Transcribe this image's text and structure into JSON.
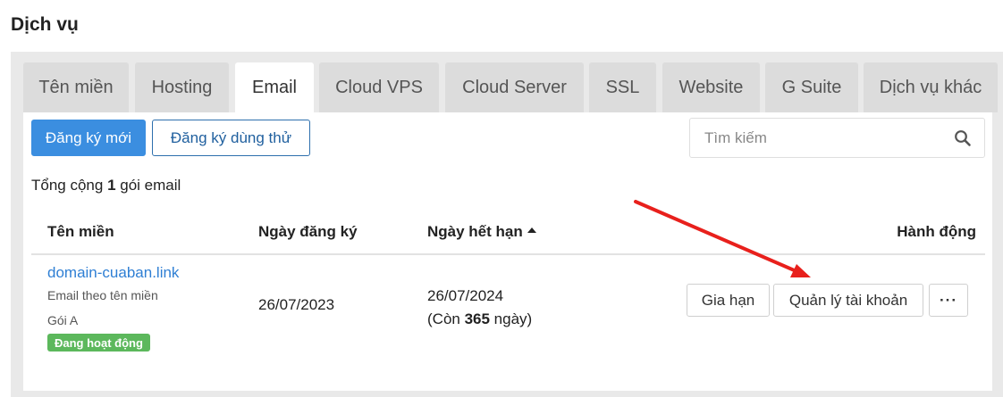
{
  "page": {
    "title": "Dịch vụ"
  },
  "tabs": [
    {
      "label": "Tên miền",
      "active": false
    },
    {
      "label": "Hosting",
      "active": false
    },
    {
      "label": "Email",
      "active": true
    },
    {
      "label": "Cloud VPS",
      "active": false
    },
    {
      "label": "Cloud Server",
      "active": false
    },
    {
      "label": "SSL",
      "active": false
    },
    {
      "label": "Website",
      "active": false
    },
    {
      "label": "G Suite",
      "active": false
    },
    {
      "label": "Dịch vụ khác",
      "active": false
    }
  ],
  "toolbar": {
    "register_new_label": "Đăng ký mới",
    "register_trial_label": "Đăng ký dùng thử",
    "search_placeholder": "Tìm kiếm",
    "search_icon": "search-icon"
  },
  "summary": {
    "prefix": "Tổng cộng ",
    "count": "1",
    "suffix": " gói email"
  },
  "table": {
    "headers": {
      "domain": "Tên miền",
      "registered": "Ngày đăng ký",
      "expires": "Ngày hết hạn",
      "actions": "Hành động"
    },
    "sort": {
      "column": "expires",
      "direction": "asc",
      "icon": "sort-up-icon"
    },
    "rows": [
      {
        "domain": "domain-cuaban.link",
        "type": "Email theo tên miền",
        "package": "Gói A",
        "status": "Đang hoạt động",
        "registered": "26/07/2023",
        "expires": "26/07/2024",
        "remaining_prefix": "(Còn ",
        "remaining_days": "365",
        "remaining_suffix": " ngày)",
        "actions": {
          "renew_label": "Gia hạn",
          "manage_label": "Quản lý tài khoản",
          "more_label": "···"
        }
      }
    ]
  },
  "colors": {
    "primary": "#3b8ee0",
    "link": "#2f7fd4",
    "status_active": "#5cb85c",
    "annotation_arrow": "#e8201c"
  }
}
